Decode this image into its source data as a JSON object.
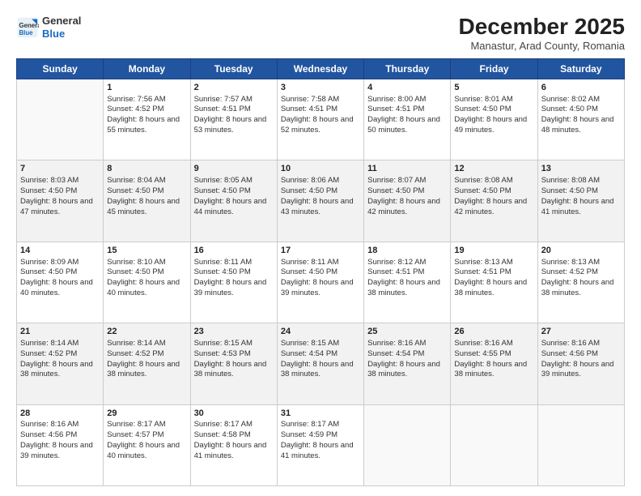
{
  "header": {
    "logo_general": "General",
    "logo_blue": "Blue",
    "month": "December 2025",
    "location": "Manastur, Arad County, Romania"
  },
  "days": [
    "Sunday",
    "Monday",
    "Tuesday",
    "Wednesday",
    "Thursday",
    "Friday",
    "Saturday"
  ],
  "weeks": [
    [
      {
        "day": "",
        "content": ""
      },
      {
        "day": "1",
        "sunrise": "7:56 AM",
        "sunset": "4:52 PM",
        "daylight": "8 hours and 55 minutes."
      },
      {
        "day": "2",
        "sunrise": "7:57 AM",
        "sunset": "4:51 PM",
        "daylight": "8 hours and 53 minutes."
      },
      {
        "day": "3",
        "sunrise": "7:58 AM",
        "sunset": "4:51 PM",
        "daylight": "8 hours and 52 minutes."
      },
      {
        "day": "4",
        "sunrise": "8:00 AM",
        "sunset": "4:51 PM",
        "daylight": "8 hours and 50 minutes."
      },
      {
        "day": "5",
        "sunrise": "8:01 AM",
        "sunset": "4:50 PM",
        "daylight": "8 hours and 49 minutes."
      },
      {
        "day": "6",
        "sunrise": "8:02 AM",
        "sunset": "4:50 PM",
        "daylight": "8 hours and 48 minutes."
      }
    ],
    [
      {
        "day": "7",
        "sunrise": "8:03 AM",
        "sunset": "4:50 PM",
        "daylight": "8 hours and 47 minutes."
      },
      {
        "day": "8",
        "sunrise": "8:04 AM",
        "sunset": "4:50 PM",
        "daylight": "8 hours and 45 minutes."
      },
      {
        "day": "9",
        "sunrise": "8:05 AM",
        "sunset": "4:50 PM",
        "daylight": "8 hours and 44 minutes."
      },
      {
        "day": "10",
        "sunrise": "8:06 AM",
        "sunset": "4:50 PM",
        "daylight": "8 hours and 43 minutes."
      },
      {
        "day": "11",
        "sunrise": "8:07 AM",
        "sunset": "4:50 PM",
        "daylight": "8 hours and 42 minutes."
      },
      {
        "day": "12",
        "sunrise": "8:08 AM",
        "sunset": "4:50 PM",
        "daylight": "8 hours and 42 minutes."
      },
      {
        "day": "13",
        "sunrise": "8:08 AM",
        "sunset": "4:50 PM",
        "daylight": "8 hours and 41 minutes."
      }
    ],
    [
      {
        "day": "14",
        "sunrise": "8:09 AM",
        "sunset": "4:50 PM",
        "daylight": "8 hours and 40 minutes."
      },
      {
        "day": "15",
        "sunrise": "8:10 AM",
        "sunset": "4:50 PM",
        "daylight": "8 hours and 40 minutes."
      },
      {
        "day": "16",
        "sunrise": "8:11 AM",
        "sunset": "4:50 PM",
        "daylight": "8 hours and 39 minutes."
      },
      {
        "day": "17",
        "sunrise": "8:11 AM",
        "sunset": "4:50 PM",
        "daylight": "8 hours and 39 minutes."
      },
      {
        "day": "18",
        "sunrise": "8:12 AM",
        "sunset": "4:51 PM",
        "daylight": "8 hours and 38 minutes."
      },
      {
        "day": "19",
        "sunrise": "8:13 AM",
        "sunset": "4:51 PM",
        "daylight": "8 hours and 38 minutes."
      },
      {
        "day": "20",
        "sunrise": "8:13 AM",
        "sunset": "4:52 PM",
        "daylight": "8 hours and 38 minutes."
      }
    ],
    [
      {
        "day": "21",
        "sunrise": "8:14 AM",
        "sunset": "4:52 PM",
        "daylight": "8 hours and 38 minutes."
      },
      {
        "day": "22",
        "sunrise": "8:14 AM",
        "sunset": "4:52 PM",
        "daylight": "8 hours and 38 minutes."
      },
      {
        "day": "23",
        "sunrise": "8:15 AM",
        "sunset": "4:53 PM",
        "daylight": "8 hours and 38 minutes."
      },
      {
        "day": "24",
        "sunrise": "8:15 AM",
        "sunset": "4:54 PM",
        "daylight": "8 hours and 38 minutes."
      },
      {
        "day": "25",
        "sunrise": "8:16 AM",
        "sunset": "4:54 PM",
        "daylight": "8 hours and 38 minutes."
      },
      {
        "day": "26",
        "sunrise": "8:16 AM",
        "sunset": "4:55 PM",
        "daylight": "8 hours and 38 minutes."
      },
      {
        "day": "27",
        "sunrise": "8:16 AM",
        "sunset": "4:56 PM",
        "daylight": "8 hours and 39 minutes."
      }
    ],
    [
      {
        "day": "28",
        "sunrise": "8:16 AM",
        "sunset": "4:56 PM",
        "daylight": "8 hours and 39 minutes."
      },
      {
        "day": "29",
        "sunrise": "8:17 AM",
        "sunset": "4:57 PM",
        "daylight": "8 hours and 40 minutes."
      },
      {
        "day": "30",
        "sunrise": "8:17 AM",
        "sunset": "4:58 PM",
        "daylight": "8 hours and 41 minutes."
      },
      {
        "day": "31",
        "sunrise": "8:17 AM",
        "sunset": "4:59 PM",
        "daylight": "8 hours and 41 minutes."
      },
      {
        "day": "",
        "content": ""
      },
      {
        "day": "",
        "content": ""
      },
      {
        "day": "",
        "content": ""
      }
    ]
  ]
}
